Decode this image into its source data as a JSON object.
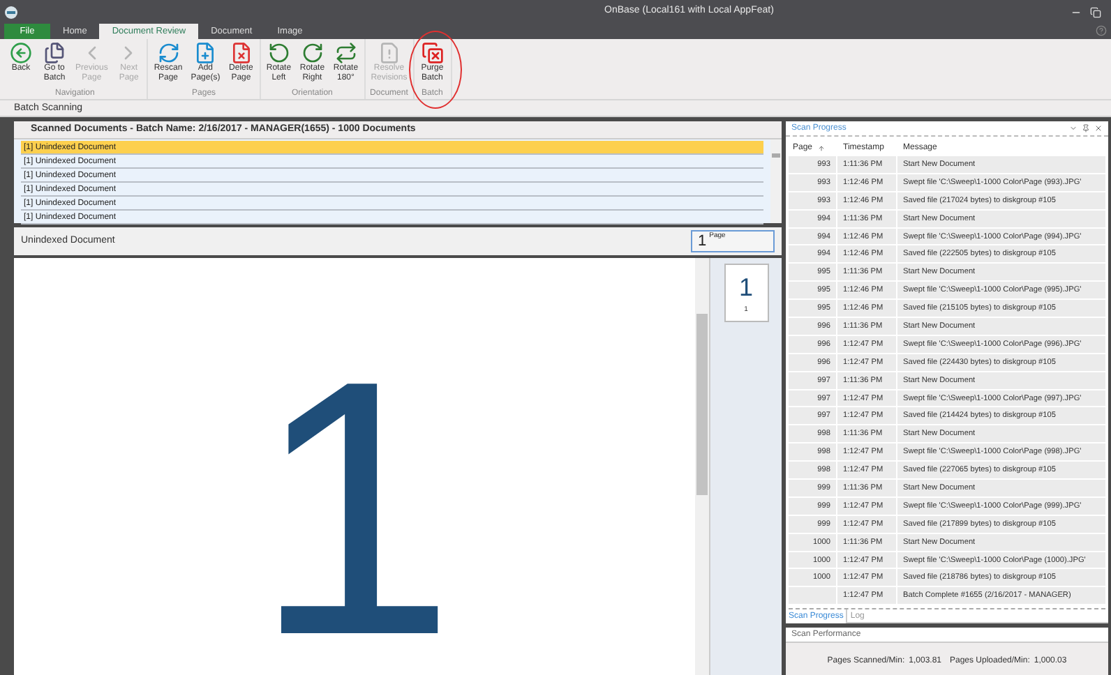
{
  "window": {
    "title": "OnBase (Local161 with Local AppFeat)"
  },
  "tabs": [
    {
      "label": "File",
      "kind": "file",
      "selected": false
    },
    {
      "label": "Home",
      "kind": "tab",
      "selected": false
    },
    {
      "label": "Document Review",
      "kind": "tab",
      "selected": true
    },
    {
      "label": "Document",
      "kind": "tab",
      "selected": false
    },
    {
      "label": "Image",
      "kind": "tab",
      "selected": false
    }
  ],
  "ribbon": [
    {
      "group": "Navigation",
      "buttons": [
        {
          "lines": [
            "Back"
          ],
          "disabled": false,
          "circled": false
        },
        {
          "lines": [
            "Go to",
            "Batch"
          ],
          "disabled": false,
          "circled": false
        },
        {
          "lines": [
            "Previous",
            "Page"
          ],
          "disabled": true,
          "circled": false
        },
        {
          "lines": [
            "Next",
            "Page"
          ],
          "disabled": true,
          "circled": false
        }
      ]
    },
    {
      "group": "Pages",
      "buttons": [
        {
          "lines": [
            "Rescan",
            "Page"
          ],
          "disabled": false,
          "circled": false
        },
        {
          "lines": [
            "Add",
            "Page(s)"
          ],
          "disabled": false,
          "circled": false
        },
        {
          "lines": [
            "Delete",
            "Page"
          ],
          "disabled": false,
          "circled": false
        }
      ]
    },
    {
      "group": "Orientation",
      "buttons": [
        {
          "lines": [
            "Rotate",
            "Left"
          ],
          "disabled": false,
          "circled": false
        },
        {
          "lines": [
            "Rotate",
            "Right"
          ],
          "disabled": false,
          "circled": false
        },
        {
          "lines": [
            "Rotate",
            "180°"
          ],
          "disabled": false,
          "circled": false
        }
      ]
    },
    {
      "group": "Document",
      "buttons": [
        {
          "lines": [
            "Resolve",
            "Revisions"
          ],
          "disabled": true,
          "circled": false
        }
      ]
    },
    {
      "group": "Batch",
      "buttons": [
        {
          "lines": [
            "Purge",
            "Batch"
          ],
          "disabled": false,
          "circled": true
        }
      ]
    }
  ],
  "section_title": "Batch Scanning",
  "documents": {
    "header": "Scanned Documents - Batch Name: 2/16/2017 - MANAGER(1655) - 1000 Documents",
    "items": [
      {
        "label": "[1] Unindexed Document",
        "selected": true
      },
      {
        "label": "[1] Unindexed Document",
        "selected": false
      },
      {
        "label": "[1] Unindexed Document",
        "selected": false
      },
      {
        "label": "[1] Unindexed Document",
        "selected": false
      },
      {
        "label": "[1] Unindexed Document",
        "selected": false
      },
      {
        "label": "[1] Unindexed Document",
        "selected": false
      }
    ]
  },
  "viewer": {
    "title": "Unindexed Document",
    "page_number": "1",
    "page_label": "Page",
    "page_text": "1",
    "thumbnail": {
      "text": "1",
      "caption": "1"
    }
  },
  "scan_progress": {
    "title": "Scan Progress",
    "columns": [
      "Page",
      "Timestamp",
      "Message"
    ],
    "rows": [
      [
        "993",
        "1:11:36 PM",
        "Start New Document"
      ],
      [
        "993",
        "1:12:46 PM",
        "Swept file 'C:\\Sweep\\1-1000 Color\\Page (993).JPG'"
      ],
      [
        "993",
        "1:12:46 PM",
        "Saved file (217024 bytes) to diskgroup #105"
      ],
      [
        "994",
        "1:11:36 PM",
        "Start New Document"
      ],
      [
        "994",
        "1:12:46 PM",
        "Swept file 'C:\\Sweep\\1-1000 Color\\Page (994).JPG'"
      ],
      [
        "994",
        "1:12:46 PM",
        "Saved file (222505 bytes) to diskgroup #105"
      ],
      [
        "995",
        "1:11:36 PM",
        "Start New Document"
      ],
      [
        "995",
        "1:12:46 PM",
        "Swept file 'C:\\Sweep\\1-1000 Color\\Page (995).JPG'"
      ],
      [
        "995",
        "1:12:46 PM",
        "Saved file (215105 bytes) to diskgroup #105"
      ],
      [
        "996",
        "1:11:36 PM",
        "Start New Document"
      ],
      [
        "996",
        "1:12:47 PM",
        "Swept file 'C:\\Sweep\\1-1000 Color\\Page (996).JPG'"
      ],
      [
        "996",
        "1:12:47 PM",
        "Saved file (224430 bytes) to diskgroup #105"
      ],
      [
        "997",
        "1:11:36 PM",
        "Start New Document"
      ],
      [
        "997",
        "1:12:47 PM",
        "Swept file 'C:\\Sweep\\1-1000 Color\\Page (997).JPG'"
      ],
      [
        "997",
        "1:12:47 PM",
        "Saved file (214424 bytes) to diskgroup #105"
      ],
      [
        "998",
        "1:11:36 PM",
        "Start New Document"
      ],
      [
        "998",
        "1:12:47 PM",
        "Swept file 'C:\\Sweep\\1-1000 Color\\Page (998).JPG'"
      ],
      [
        "998",
        "1:12:47 PM",
        "Saved file (227065 bytes) to diskgroup #105"
      ],
      [
        "999",
        "1:11:36 PM",
        "Start New Document"
      ],
      [
        "999",
        "1:12:47 PM",
        "Swept file 'C:\\Sweep\\1-1000 Color\\Page (999).JPG'"
      ],
      [
        "999",
        "1:12:47 PM",
        "Saved file (217899 bytes) to diskgroup #105"
      ],
      [
        "1000",
        "1:11:36 PM",
        "Start New Document"
      ],
      [
        "1000",
        "1:12:47 PM",
        "Swept file 'C:\\Sweep\\1-1000 Color\\Page (1000).JPG'"
      ],
      [
        "1000",
        "1:12:47 PM",
        "Saved file (218786 bytes) to diskgroup #105"
      ],
      [
        "",
        "1:12:47 PM",
        "Batch Complete #1655 (2/16/2017 - MANAGER)"
      ]
    ],
    "tabs": [
      {
        "label": "Scan Progress",
        "selected": true
      },
      {
        "label": "Log",
        "selected": false
      }
    ]
  },
  "scan_performance": {
    "title": "Scan Performance",
    "stats": [
      {
        "label": "Pages Scanned/Min:",
        "value": "1,003.81"
      },
      {
        "label": "Pages Uploaded/Min:",
        "value": "1,000.03"
      }
    ]
  }
}
